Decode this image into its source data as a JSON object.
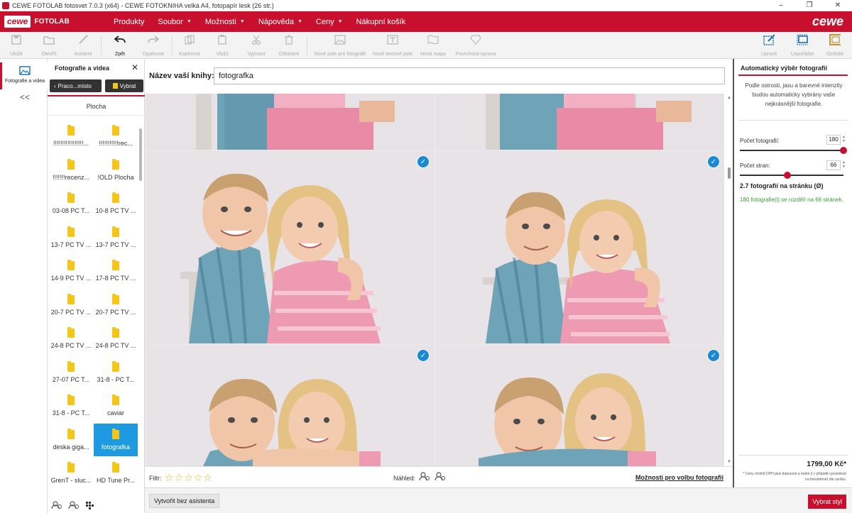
{
  "window": {
    "title": "CEWE FOTOLAB fotosvet 7.0.3 (x64) - CEWE FOTOKNIHA velká A4, fotopapír lesk (26 str.)",
    "controls": [
      "–",
      "❐",
      "✕"
    ]
  },
  "menubar": {
    "logo_cewe": "cewe",
    "logo_fotolab": "FOTOLAB",
    "brand": "cewe",
    "items": [
      {
        "label": "Produkty",
        "caret": false
      },
      {
        "label": "Soubor",
        "caret": true
      },
      {
        "label": "Možnosti",
        "caret": true
      },
      {
        "label": "Nápověda",
        "caret": true
      },
      {
        "label": "Ceny",
        "caret": true
      },
      {
        "label": "Nákupní košík",
        "caret": false
      }
    ]
  },
  "toolbar": {
    "save": "Uložit",
    "open": "Otevřít",
    "assistant": "Asistent",
    "undo": "Zpět",
    "redo": "Opakovat",
    "copy": "Kopírovat",
    "paste": "Vložit",
    "cut": "Vyjmout",
    "delete": "Odstranit",
    "new_photo_field": "Nové pole pro fotografii",
    "new_text_field": "Nové textové pole",
    "new_map": "Nová mapa",
    "surface": "Povrchová úprava",
    "edit": "Upravit",
    "arrange": "Uspořádat",
    "decorate": "Ozdobit"
  },
  "leftrail": {
    "tab_label": "Fotografie a videa",
    "collapse": "<<"
  },
  "files_panel": {
    "title": "Fotografie a videa",
    "back_button": "Praco...místo",
    "select_button": "Vybrat",
    "location": "Plocha",
    "folders": [
      "!!!!!!!!!!!!!!!!!...",
      "!!!!!!!!!!!rec...",
      "!!!!!!!recenz...",
      "!OLD Plocha",
      "03-08 PC T...",
      "10-8 PC TV ...",
      "13-7 PC TV ...",
      "13-7 PC TV ...",
      "14-9 PC TV ...",
      "17-8 PC TV ...",
      "20-7 PC TV ...",
      "20-7 PC TV ...",
      "24-8 PC TV ...",
      "24-8 PC TV ...",
      "27-07 PC T...",
      "31-8 - PC T...",
      "31-8 - PC T...",
      "caviar",
      "deska giga...",
      "fotografka",
      "GrenT - sluc...",
      "HD Tune Pr..."
    ],
    "selected_index": 19
  },
  "main": {
    "book_title_label": "Název vaší knihy:",
    "book_title_value": "fotografka",
    "filter_label": "Filtr:",
    "stars": [
      "☆",
      "☆",
      "☆",
      "☆",
      "☆"
    ],
    "preview_label": "Náhled:",
    "options_link": "Možnosti pro volbu fotografií",
    "check_glyph": "✓"
  },
  "bottom": {
    "no_assistant": "Vytvořit bez asistenta",
    "choose_style": "Vybrat styl"
  },
  "right_panel": {
    "title": "Automatický výběr fotografií",
    "description": "Podle ostrosti, jasu a barevné intenzity budou automaticky vybrány vaše nejkrásnější fotografie.",
    "photos_label": "Počet fotografií:",
    "photos_value": "180",
    "pages_label": "Počet stran:",
    "pages_value": "66",
    "avg": "2.7 fotografií na stránku (Ø)",
    "distribution": "180 fotografie(i) se rozdělí na 66 stránek.",
    "price": "1799,00 Kč*",
    "note": "* Ceny včetně DPH plus dopravné a balné (i v případě vyzvednutí na fotosběrně) dle ceníku.",
    "sliders": {
      "photos_fraction": 1.0,
      "pages_fraction": 0.46
    }
  },
  "colors": {
    "accent": "#c8102e",
    "check": "#1a8ad4",
    "selected": "#1e9be0"
  }
}
